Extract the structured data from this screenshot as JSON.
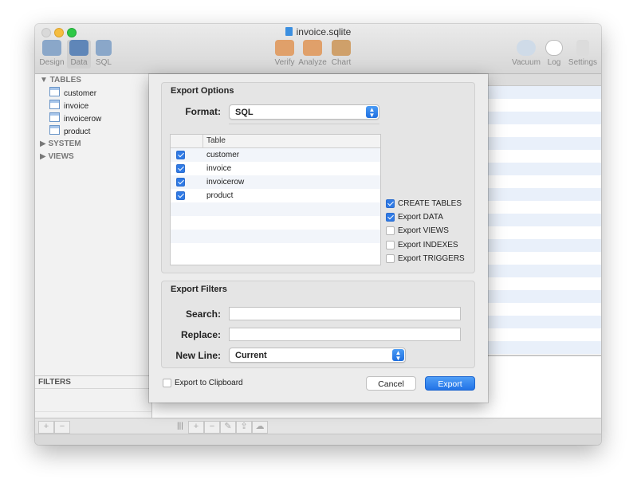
{
  "window": {
    "title": "invoice.sqlite"
  },
  "toolbar": {
    "left": [
      {
        "label": "Design"
      },
      {
        "label": "Data"
      },
      {
        "label": "SQL"
      }
    ],
    "center": [
      {
        "label": "Verify"
      },
      {
        "label": "Analyze"
      },
      {
        "label": "Chart"
      }
    ],
    "right": [
      {
        "label": "Vacuum"
      },
      {
        "label": "Log"
      },
      {
        "label": "Settings"
      }
    ]
  },
  "sidebar": {
    "tables_header": "▼ TABLES",
    "tables": [
      "customer",
      "invoice",
      "invoicerow",
      "product"
    ],
    "system_header": "▶ SYSTEM",
    "views_header": "▶ VIEWS",
    "filters_header": "FILTERS"
  },
  "dialog": {
    "options_title": "Export Options",
    "format_label": "Format:",
    "format_value": "SQL",
    "table_header": "Table",
    "tables": [
      {
        "name": "customer",
        "checked": true
      },
      {
        "name": "invoice",
        "checked": true
      },
      {
        "name": "invoicerow",
        "checked": true
      },
      {
        "name": "product",
        "checked": true
      }
    ],
    "options": [
      {
        "label": "CREATE TABLES",
        "checked": true
      },
      {
        "label": "Export DATA",
        "checked": true
      },
      {
        "label": "Export VIEWS",
        "checked": false
      },
      {
        "label": "Export INDEXES",
        "checked": false
      },
      {
        "label": "Export TRIGGERS",
        "checked": false
      }
    ],
    "filters_title": "Export Filters",
    "search_label": "Search:",
    "search_value": "",
    "replace_label": "Replace:",
    "replace_value": "",
    "newline_label": "New Line:",
    "newline_value": "Current",
    "clipboard_label": "Export to Clipboard",
    "clipboard_checked": false,
    "cancel_label": "Cancel",
    "export_label": "Export"
  },
  "colors": {
    "accent": "#2f7ae5",
    "row_stripe": "#e9f0fa"
  }
}
